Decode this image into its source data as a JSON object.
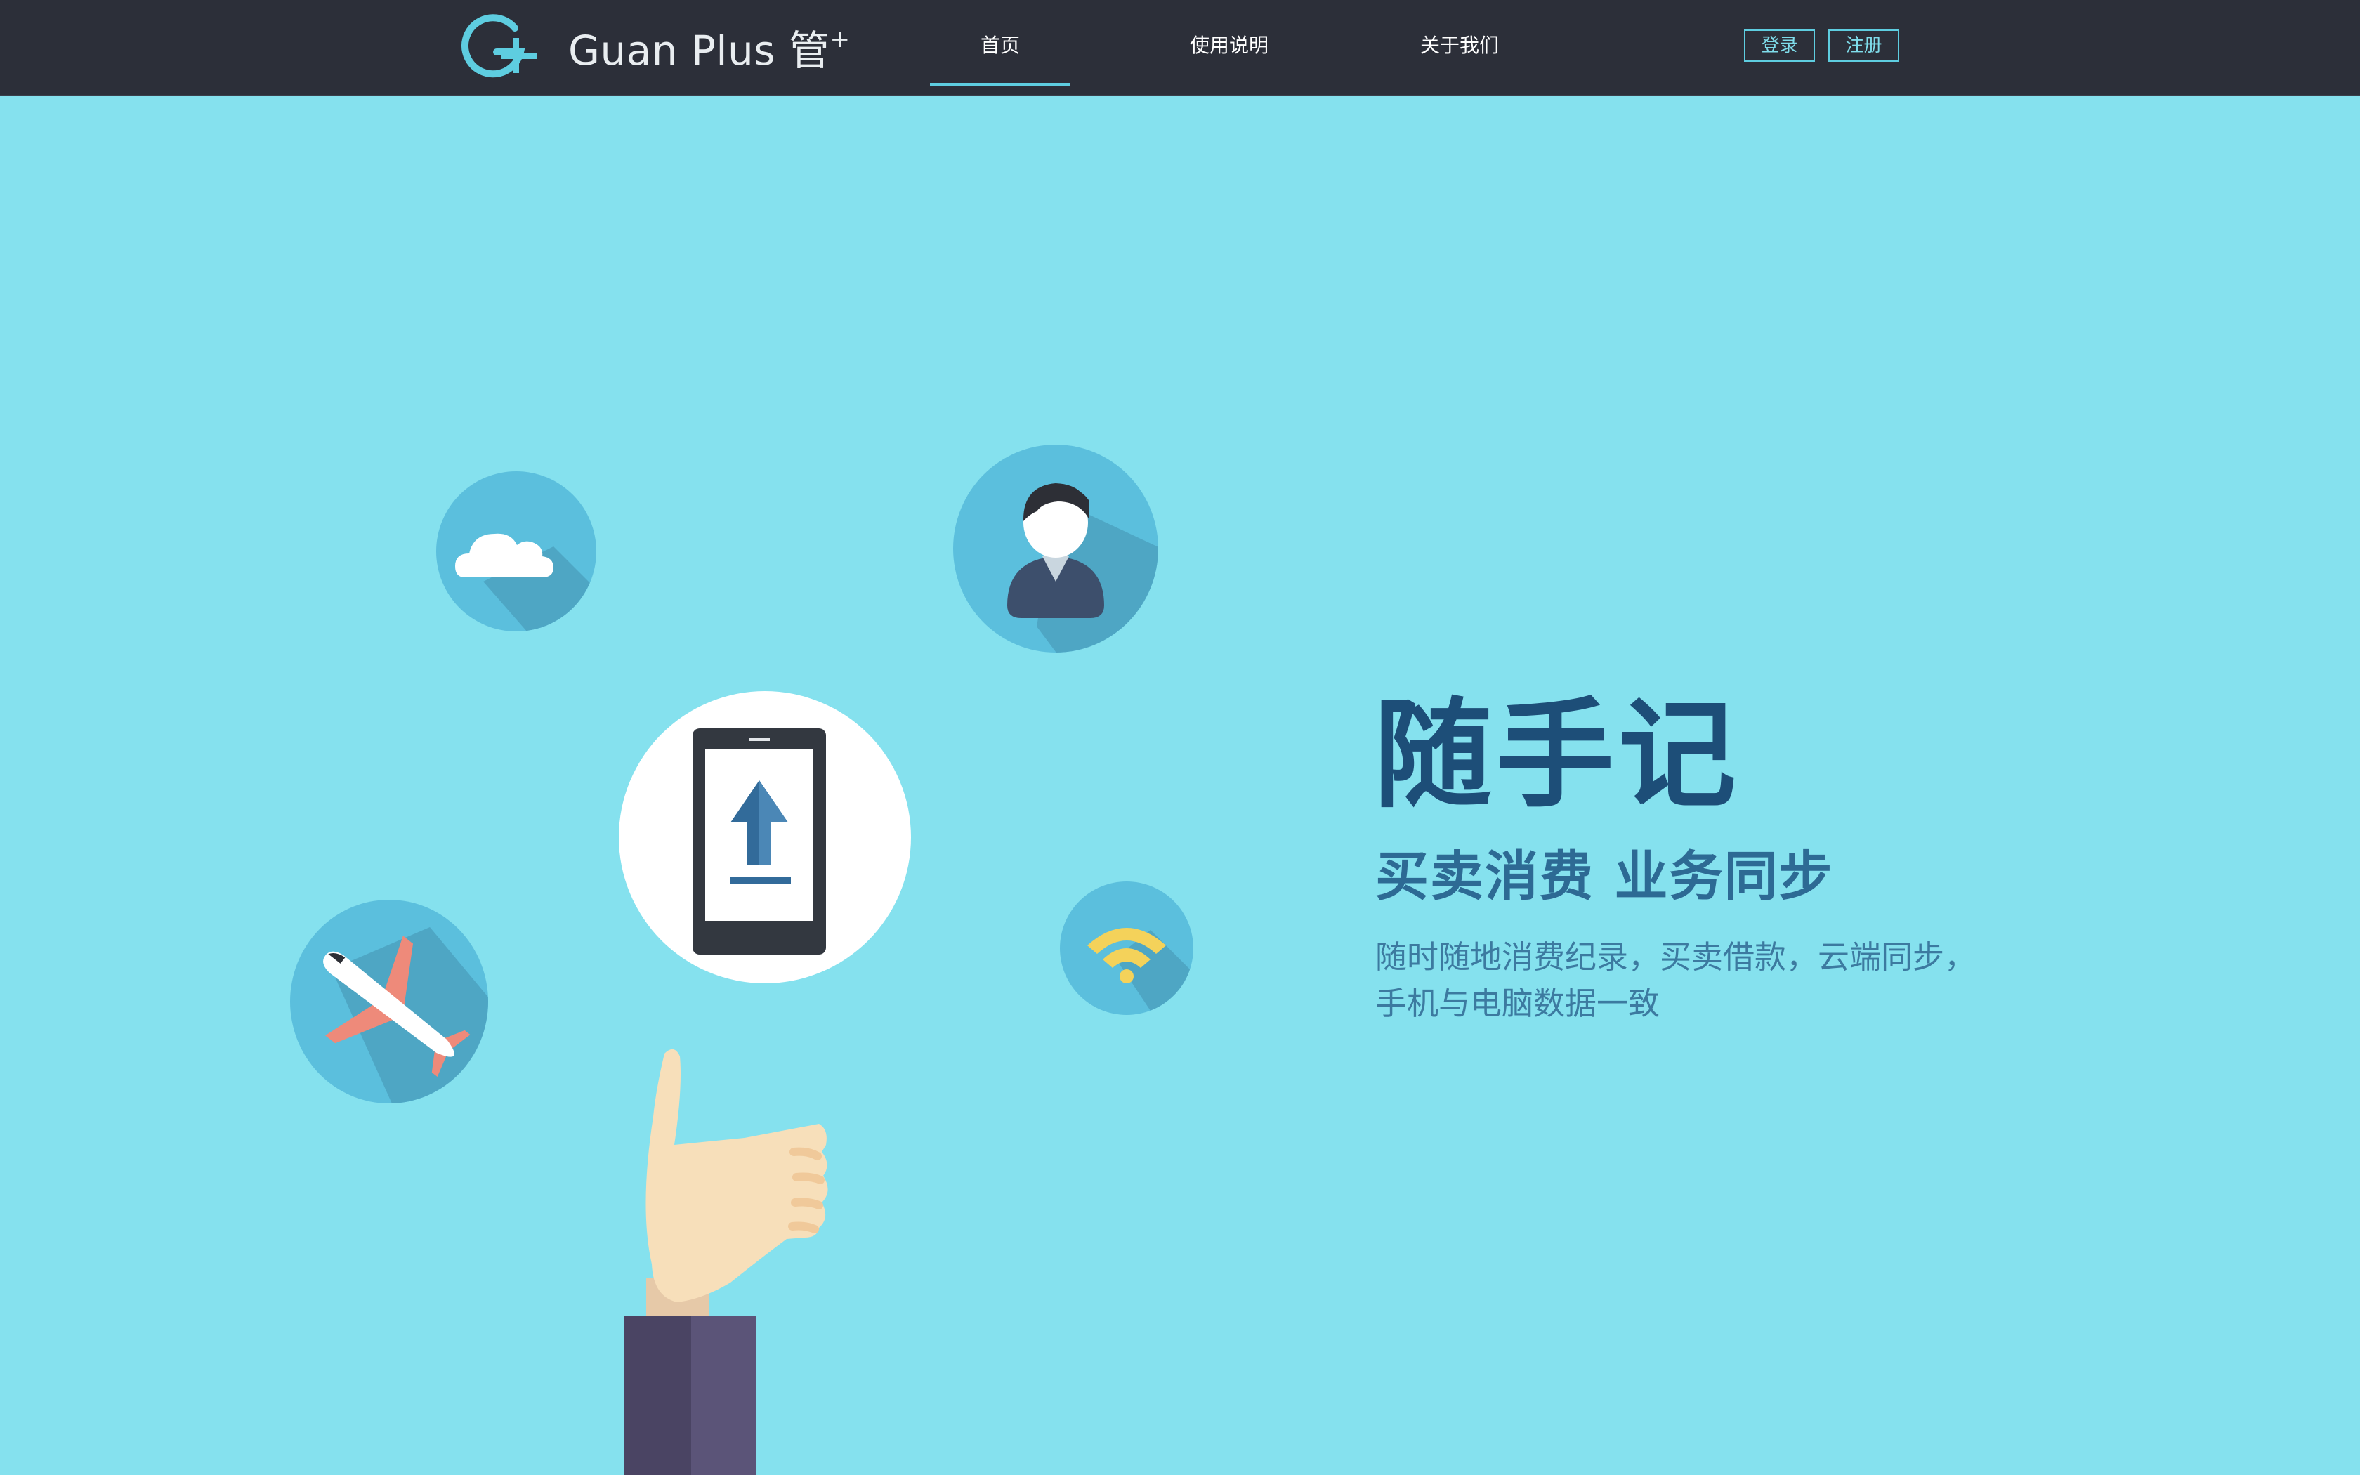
{
  "header": {
    "brand": {
      "name": "Guan Plus",
      "cn_name": "管",
      "plus_sign": "+",
      "logo_icon": "g-plus-logo-icon"
    },
    "nav": [
      {
        "label": "首页",
        "active": true
      },
      {
        "label": "使用说明",
        "active": false
      },
      {
        "label": "关于我们",
        "active": false
      }
    ],
    "login_label": "登录",
    "register_label": "注册"
  },
  "hero": {
    "title": "随手记",
    "subtitle": "买卖消费 业务同步",
    "description_line1": "随时随地消费纪录，买卖借款，云端同步，",
    "description_line2": "手机与电脑数据一致"
  },
  "illustration": {
    "icons": [
      "cloud-icon",
      "user-icon",
      "phone-upload-icon",
      "wifi-icon",
      "airplane-icon",
      "hand-icon"
    ]
  },
  "colors": {
    "background": "#85e1ee",
    "navbar": "#2c2f39",
    "accent": "#5ecde0",
    "title": "#1d4e78",
    "subtitle": "#2d6a94",
    "description": "#3c7aa0",
    "icon_circle": "#5bbfdd"
  }
}
